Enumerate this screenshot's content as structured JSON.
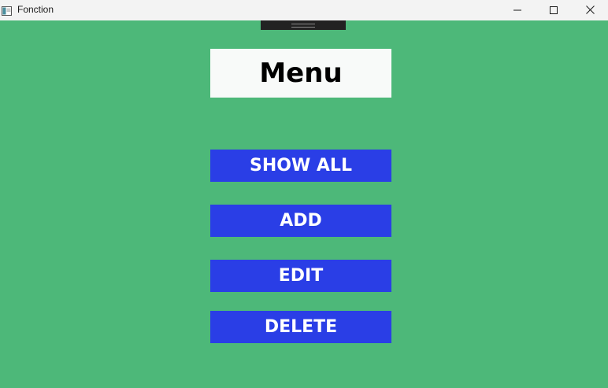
{
  "window": {
    "title": "Fonction",
    "background": "#4db879"
  },
  "header": {
    "title": "Menu"
  },
  "menu": {
    "show_all_label": "SHOW ALL",
    "add_label": "ADD",
    "edit_label": "EDIT",
    "delete_label": "DELETE",
    "button_color": "#2a3ee6"
  },
  "icons": {
    "app": "app-window-icon",
    "minimize": "minimize-icon",
    "maximize": "maximize-icon",
    "close": "close-icon"
  }
}
